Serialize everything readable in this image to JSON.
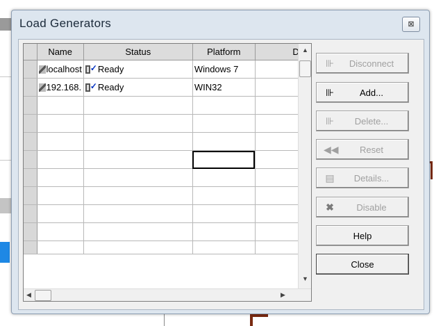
{
  "dialog": {
    "title": "Load Generators",
    "close_glyph": "⊠"
  },
  "grid": {
    "columns": [
      "Name",
      "Status",
      "Platform",
      "D"
    ],
    "rows": [
      {
        "name": "localhost",
        "status": "Ready",
        "platform": "Windows 7"
      },
      {
        "name": "192.168.",
        "status": "Ready",
        "platform": "WIN32"
      }
    ]
  },
  "buttons": {
    "disconnect": "Disconnect",
    "add": "Add...",
    "delete": "Delete...",
    "reset": "Reset",
    "details": "Details...",
    "disable": "Disable",
    "help": "Help",
    "close": "Close"
  },
  "icons": {
    "disconnect": "disconnect-icon",
    "add": "add-generator-icon",
    "delete": "delete-generator-icon",
    "reset": "reset-icon",
    "details": "details-icon",
    "disable": "disable-x-icon",
    "plug": "plug-icon",
    "status": "server-status-icon"
  },
  "colors": {
    "dialog_bg": "#dde6ef",
    "header_name": "#0000d0",
    "disabled_text": "#a0a0a0"
  }
}
